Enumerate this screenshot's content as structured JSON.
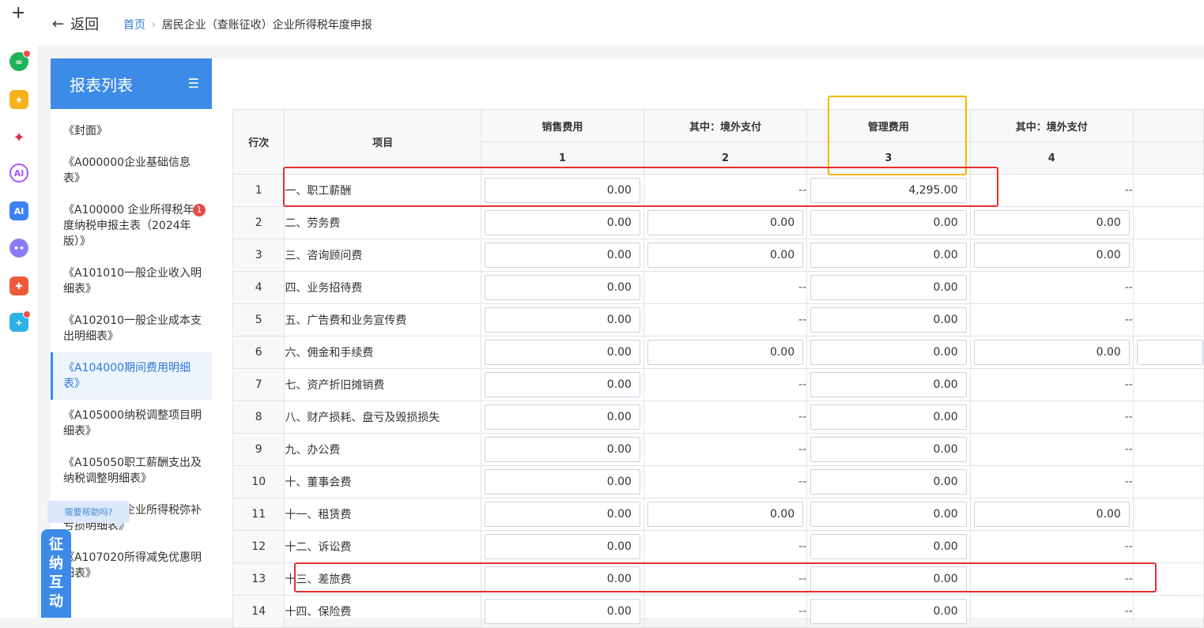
{
  "nav": {
    "back_label": "返回",
    "breadcrumb": [
      "首页",
      "居民企业（查账征收）企业所得税年度申报"
    ]
  },
  "rail": {
    "icons": [
      "plus-icon",
      "link-app-icon",
      "star-app-icon",
      "network-app-icon",
      "ai-circle-app-icon",
      "ai-app-icon",
      "robot-app-icon",
      "game-app-icon",
      "plus-app-icon"
    ]
  },
  "sidebar": {
    "title": "报表列表",
    "items": [
      {
        "label": "《封面》"
      },
      {
        "label": "《A000000企业基础信息表》"
      },
      {
        "label": "《A100000 企业所得税年度纳税申报主表（2024年版）》",
        "badge": "1"
      },
      {
        "label": "《A101010一般企业收入明细表》"
      },
      {
        "label": "《A102010一般企业成本支出明细表》"
      },
      {
        "label": "《A104000期间费用明细表》",
        "active": true
      },
      {
        "label": "《A105000纳税调整项目明细表》"
      },
      {
        "label": "《A105050职工薪酬支出及纳税调整明细表》"
      },
      {
        "label": "《A106000企业所得税弥补亏损明细表》"
      },
      {
        "label": "《A107020所得减免优惠明细表》"
      }
    ]
  },
  "help": {
    "tip": "需要帮助吗?",
    "button": [
      "征",
      "纳",
      "互",
      "动"
    ]
  },
  "table": {
    "headers": {
      "row_no": "行次",
      "item": "项目",
      "cols": [
        "销售费用",
        "其中：境外支付",
        "管理费用",
        "其中：境外支付"
      ],
      "col_nums": [
        "1",
        "2",
        "3",
        "4"
      ]
    },
    "rows": [
      {
        "no": "1",
        "name": "一、职工薪酬",
        "c1": "0.00",
        "c2": "--",
        "c3": "4,295.00",
        "c4": "--"
      },
      {
        "no": "2",
        "name": "二、劳务费",
        "c1": "0.00",
        "c2": "0.00",
        "c3": "0.00",
        "c4": "0.00"
      },
      {
        "no": "3",
        "name": "三、咨询顾问费",
        "c1": "0.00",
        "c2": "0.00",
        "c3": "0.00",
        "c4": "0.00"
      },
      {
        "no": "4",
        "name": "四、业务招待费",
        "c1": "0.00",
        "c2": "--",
        "c3": "0.00",
        "c4": "--"
      },
      {
        "no": "5",
        "name": "五、广告费和业务宣传费",
        "c1": "0.00",
        "c2": "--",
        "c3": "0.00",
        "c4": "--"
      },
      {
        "no": "6",
        "name": "六、佣金和手续费",
        "c1": "0.00",
        "c2": "0.00",
        "c3": "0.00",
        "c4": "0.00"
      },
      {
        "no": "7",
        "name": "七、资产折旧摊销费",
        "c1": "0.00",
        "c2": "--",
        "c3": "0.00",
        "c4": "--"
      },
      {
        "no": "8",
        "name": "八、财产损耗、盘亏及毁损损失",
        "c1": "0.00",
        "c2": "--",
        "c3": "0.00",
        "c4": "--"
      },
      {
        "no": "9",
        "name": "九、办公费",
        "c1": "0.00",
        "c2": "--",
        "c3": "0.00",
        "c4": "--"
      },
      {
        "no": "10",
        "name": "十、董事会费",
        "c1": "0.00",
        "c2": "--",
        "c3": "0.00",
        "c4": "--"
      },
      {
        "no": "11",
        "name": "十一、租赁费",
        "c1": "0.00",
        "c2": "0.00",
        "c3": "0.00",
        "c4": "0.00"
      },
      {
        "no": "12",
        "name": "十二、诉讼费",
        "c1": "0.00",
        "c2": "--",
        "c3": "0.00",
        "c4": "--"
      },
      {
        "no": "13",
        "name": "十三、差旅费",
        "c1": "0.00",
        "c2": "--",
        "c3": "0.00",
        "c4": "--"
      },
      {
        "no": "14",
        "name": "十四、保险费",
        "c1": "0.00",
        "c2": "--",
        "c3": "0.00",
        "c4": "--"
      }
    ]
  },
  "colors": {
    "accent": "#3d8be8",
    "highlight_red": "#e53030",
    "highlight_yellow": "#f5b400"
  }
}
